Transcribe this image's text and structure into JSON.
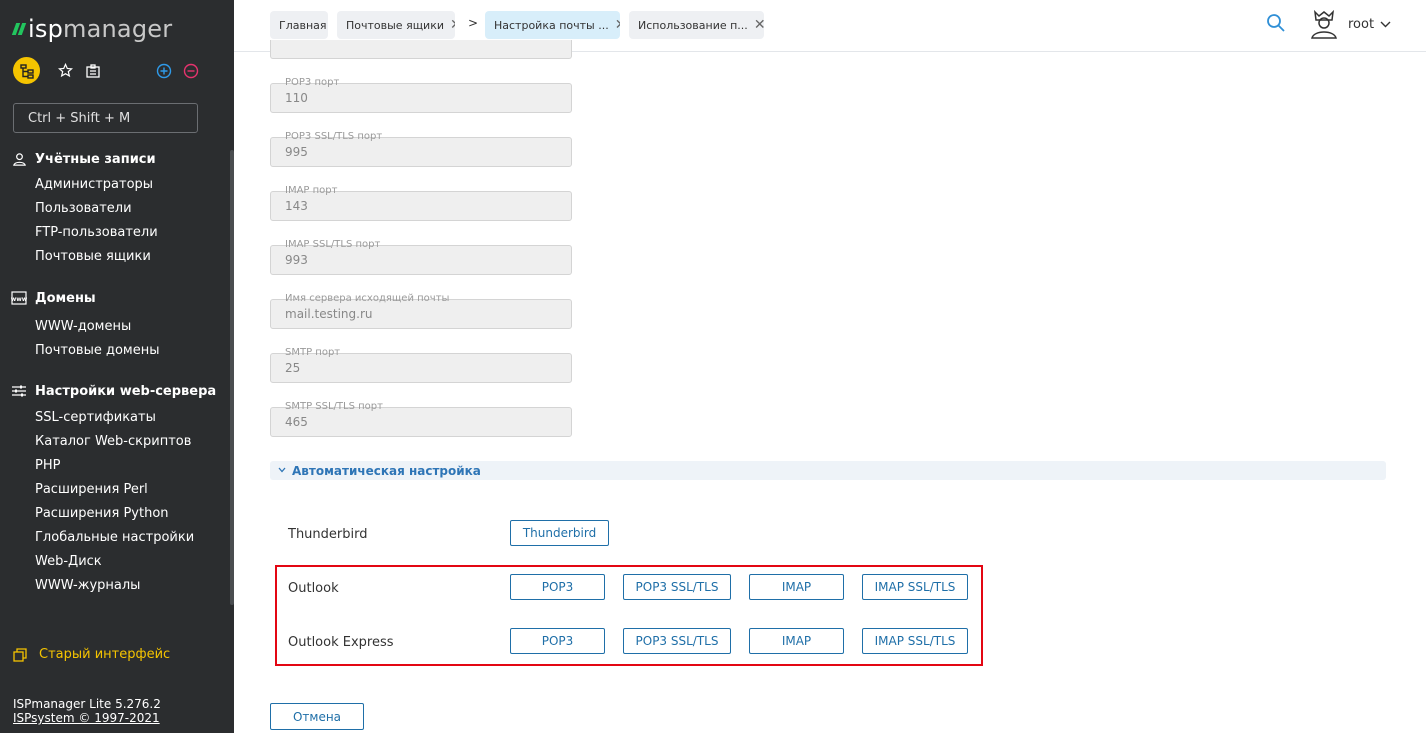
{
  "sidebar": {
    "logo_prefix": "isp",
    "logo_suffix": "manager",
    "hotkey": "Ctrl + Shift + M",
    "groups": [
      {
        "title": "Учётные записи",
        "icon": "user-icon",
        "items": [
          "Администраторы",
          "Пользователи",
          "FTP-пользователи",
          "Почтовые ящики"
        ]
      },
      {
        "title": "Домены",
        "icon": "www-icon",
        "items": [
          "WWW-домены",
          "Почтовые домены"
        ]
      },
      {
        "title": "Настройки web-сервера",
        "icon": "sliders-icon",
        "items": [
          "SSL-сертификаты",
          "Каталог Web-скриптов",
          "PHP",
          "Расширения Perl",
          "Расширения Python",
          "Глобальные настройки",
          "Web-Диск",
          "WWW-журналы"
        ]
      }
    ],
    "old_interface": "Старый интерфейс",
    "version": "ISPmanager Lite 5.276.2",
    "copyright": "ISPsystem © 1997-2021"
  },
  "topbar": {
    "tabs": [
      "Главная",
      "Почтовые ящики",
      "Настройка почты ...",
      "Использование п..."
    ],
    "separator": ">",
    "user": "root"
  },
  "fields": [
    {
      "label": "POP3 порт",
      "value": "110"
    },
    {
      "label": "POP3 SSL/TLS порт",
      "value": "995"
    },
    {
      "label": "IMAP порт",
      "value": "143"
    },
    {
      "label": "IMAP SSL/TLS порт",
      "value": "993"
    },
    {
      "label": "Имя сервера исходящей почты",
      "value": "mail.testing.ru"
    },
    {
      "label": "SMTP порт",
      "value": "25"
    },
    {
      "label": "SMTP SSL/TLS порт",
      "value": "465"
    }
  ],
  "auto": {
    "title": "Автоматическая настройка",
    "thunderbird_label": "Thunderbird",
    "thunderbird_button": "Thunderbird",
    "outlook_label": "Outlook",
    "outlook_express_label": "Outlook Express",
    "buttons": [
      "POP3",
      "POP3 SSL/TLS",
      "IMAP",
      "IMAP SSL/TLS"
    ]
  },
  "cancel": "Отмена",
  "colors": {
    "accent": "#1f6fa8",
    "highlight": "#e30613",
    "logo": "#22c55e",
    "sidebar": "#2b2d2f"
  }
}
